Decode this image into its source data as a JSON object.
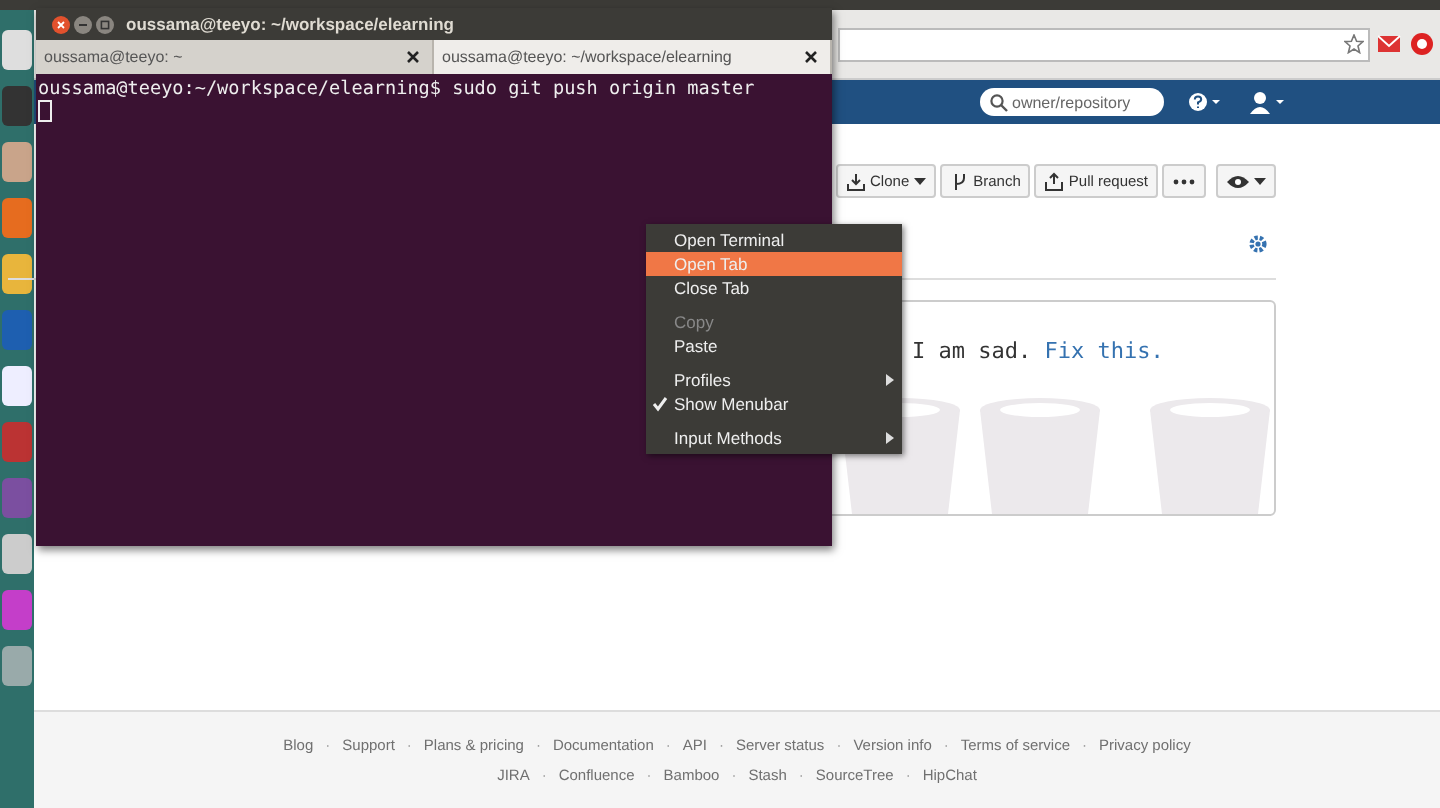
{
  "terminal": {
    "title": "oussama@teeyo: ~/workspace/elearning",
    "tabs": [
      {
        "label": "oussama@teeyo: ~",
        "selected": false
      },
      {
        "label": "oussama@teeyo: ~/workspace/elearning",
        "selected": true
      }
    ],
    "lines": [
      "oussama@teeyo:~/workspace/elearning$ sudo git push origin master"
    ]
  },
  "context_menu": {
    "items": [
      {
        "kind": "item",
        "label": "Open Terminal",
        "selected": false,
        "disabled": false
      },
      {
        "kind": "item",
        "label": "Open Tab",
        "selected": true,
        "disabled": false
      },
      {
        "kind": "item",
        "label": "Close Tab",
        "selected": false,
        "disabled": false
      },
      {
        "kind": "separator"
      },
      {
        "kind": "item",
        "label": "Copy",
        "selected": false,
        "disabled": true
      },
      {
        "kind": "item",
        "label": "Paste",
        "selected": false,
        "disabled": false
      },
      {
        "kind": "separator"
      },
      {
        "kind": "submenu",
        "label": "Profiles",
        "selected": false,
        "disabled": false
      },
      {
        "kind": "check",
        "label": "Show Menubar",
        "selected": false,
        "disabled": false,
        "checked": true
      },
      {
        "kind": "separator"
      },
      {
        "kind": "submenu",
        "label": "Input Methods",
        "selected": false,
        "disabled": false
      }
    ]
  },
  "browser": {
    "search": {
      "placeholder": "owner/repository"
    },
    "actions": [
      {
        "kind": "download",
        "label": "Clone",
        "caret": true
      },
      {
        "kind": "branch",
        "label": "Branch",
        "caret": false
      },
      {
        "kind": "upload",
        "label": "Pull request",
        "caret": false
      }
    ],
    "message": {
      "text": "I am sad.",
      "link": "Fix this."
    },
    "footer": {
      "separator": "·",
      "links": [
        "Blog",
        "Support",
        "Plans & pricing",
        "Documentation",
        "API",
        "Server status",
        "Version info",
        "Terms of service",
        "Privacy policy"
      ],
      "products": [
        "JIRA",
        "Confluence",
        "Bamboo",
        "Stash",
        "SourceTree",
        "HipChat"
      ]
    }
  }
}
